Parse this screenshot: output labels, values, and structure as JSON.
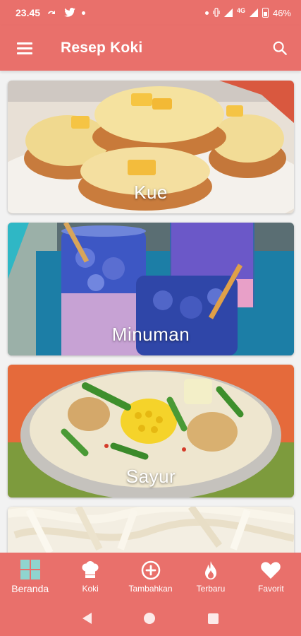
{
  "status_bar": {
    "time": "23.45",
    "network_label": "4G",
    "battery": "46%"
  },
  "app_bar": {
    "title": "Resep Koki",
    "menu_icon": "hamburger-menu-icon",
    "search_icon": "search-icon"
  },
  "categories": [
    {
      "label": "Kue"
    },
    {
      "label": "Minuman"
    },
    {
      "label": "Sayur"
    },
    {
      "label": ""
    }
  ],
  "bottom_nav": {
    "items": [
      {
        "label": "Beranda",
        "icon": "grid-icon",
        "active": true
      },
      {
        "label": "Koki",
        "icon": "chef-hat-icon",
        "active": false
      },
      {
        "label": "Tambahkan",
        "icon": "add-circle-icon",
        "active": false
      },
      {
        "label": "Terbaru",
        "icon": "fire-icon",
        "active": false
      },
      {
        "label": "Favorit",
        "icon": "heart-icon",
        "active": false
      }
    ]
  },
  "colors": {
    "primary": "#e9706b",
    "on_primary": "#ffffff"
  }
}
